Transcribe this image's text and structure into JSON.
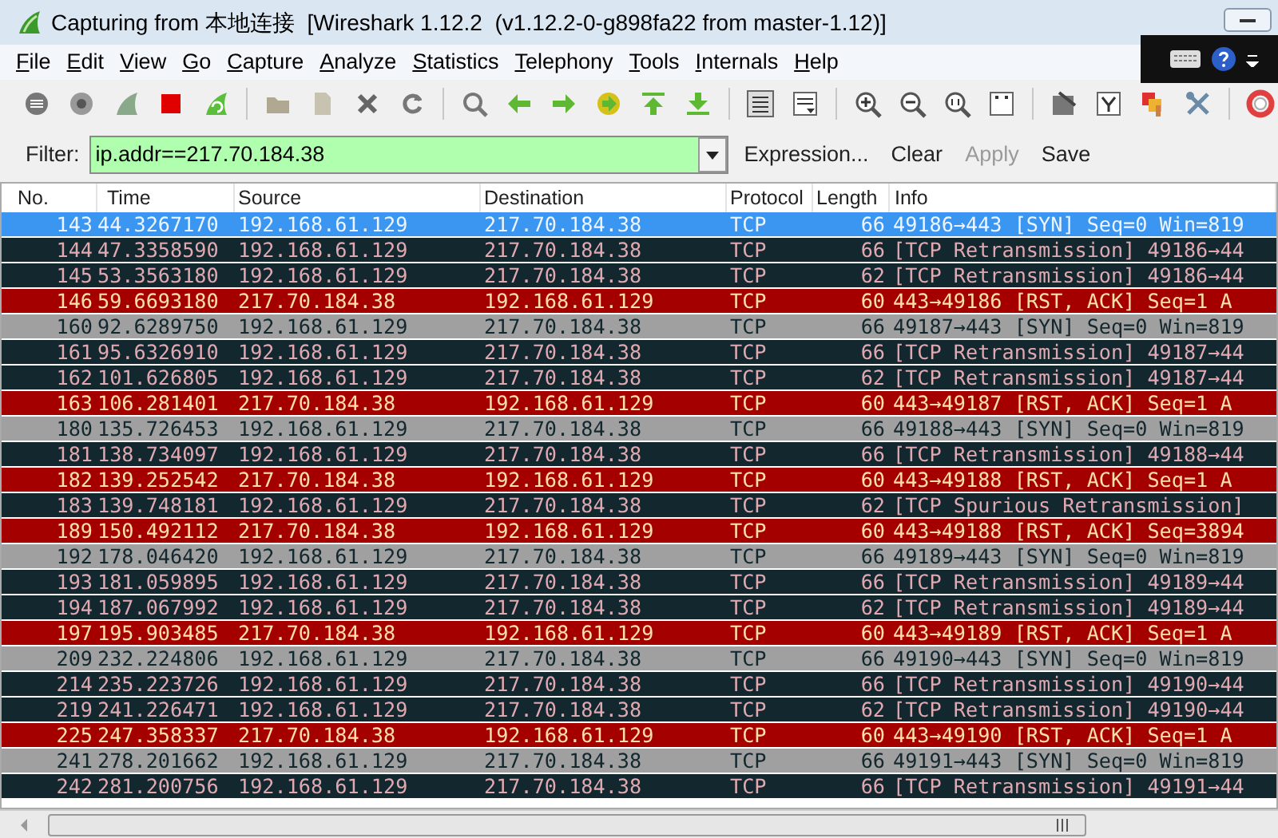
{
  "window": {
    "title": "Capturing from 本地连接  [Wireshark 1.12.2  (v1.12.2-0-g898fa22 from master-1.12)]"
  },
  "menu": [
    "File",
    "Edit",
    "View",
    "Go",
    "Capture",
    "Analyze",
    "Statistics",
    "Telephony",
    "Tools",
    "Internals",
    "Help"
  ],
  "filter": {
    "label": "Filter:",
    "value": "ip.addr==217.70.184.38"
  },
  "filter_buttons": [
    {
      "label": "Expression...",
      "disabled": false
    },
    {
      "label": "Clear",
      "disabled": false
    },
    {
      "label": "Apply",
      "disabled": true
    },
    {
      "label": "Save",
      "disabled": false
    }
  ],
  "table": {
    "columns": [
      "No.",
      "Time",
      "Source",
      "Destination",
      "Protocol",
      "Length",
      "Info"
    ],
    "rows": [
      {
        "selected": true,
        "cells": [
          "143",
          "44.3267170",
          "192.168.61.129",
          "217.70.184.38",
          "TCP",
          "66",
          "49186→443 [SYN] Seq=0 Win=819"
        ]
      },
      {
        "kind": "retransmission",
        "selected": false,
        "cells": [
          "144",
          "47.3358590",
          "192.168.61.129",
          "217.70.184.38",
          "TCP",
          "66",
          "[TCP Retransmission] 49186→44"
        ]
      },
      {
        "kind": "retransmission",
        "selected": false,
        "cells": [
          "145",
          "53.3563180",
          "192.168.61.129",
          "217.70.184.38",
          "TCP",
          "62",
          "[TCP Retransmission] 49186→44"
        ]
      },
      {
        "kind": "reset",
        "selected": false,
        "cells": [
          "146",
          "59.6693180",
          "217.70.184.38",
          "192.168.61.129",
          "TCP",
          "60",
          "443→49186 [RST, ACK] Seq=1 A"
        ]
      },
      {
        "kind": "syn",
        "selected": false,
        "cells": [
          "160",
          "92.6289750",
          "192.168.61.129",
          "217.70.184.38",
          "TCP",
          "66",
          "49187→443 [SYN] Seq=0 Win=819"
        ]
      },
      {
        "kind": "retransmission",
        "selected": false,
        "cells": [
          "161",
          "95.6326910",
          "192.168.61.129",
          "217.70.184.38",
          "TCP",
          "66",
          "[TCP Retransmission] 49187→44"
        ]
      },
      {
        "kind": "retransmission",
        "selected": false,
        "cells": [
          "162",
          "101.626805",
          "192.168.61.129",
          "217.70.184.38",
          "TCP",
          "62",
          "[TCP Retransmission] 49187→44"
        ]
      },
      {
        "kind": "reset",
        "selected": false,
        "cells": [
          "163",
          "106.281401",
          "217.70.184.38",
          "192.168.61.129",
          "TCP",
          "60",
          "443→49187 [RST, ACK] Seq=1 A"
        ]
      },
      {
        "kind": "syn",
        "selected": false,
        "cells": [
          "180",
          "135.726453",
          "192.168.61.129",
          "217.70.184.38",
          "TCP",
          "66",
          "49188→443 [SYN] Seq=0 Win=819"
        ]
      },
      {
        "kind": "retransmission",
        "selected": false,
        "cells": [
          "181",
          "138.734097",
          "192.168.61.129",
          "217.70.184.38",
          "TCP",
          "66",
          "[TCP Retransmission] 49188→44"
        ]
      },
      {
        "kind": "reset",
        "selected": false,
        "cells": [
          "182",
          "139.252542",
          "217.70.184.38",
          "192.168.61.129",
          "TCP",
          "60",
          "443→49188 [RST, ACK] Seq=1 A"
        ]
      },
      {
        "kind": "retransmission",
        "selected": false,
        "cells": [
          "183",
          "139.748181",
          "192.168.61.129",
          "217.70.184.38",
          "TCP",
          "62",
          "[TCP Spurious Retransmission]"
        ]
      },
      {
        "kind": "reset",
        "selected": false,
        "cells": [
          "189",
          "150.492112",
          "217.70.184.38",
          "192.168.61.129",
          "TCP",
          "60",
          "443→49188 [RST, ACK] Seq=3894"
        ]
      },
      {
        "kind": "syn",
        "selected": false,
        "cells": [
          "192",
          "178.046420",
          "192.168.61.129",
          "217.70.184.38",
          "TCP",
          "66",
          "49189→443 [SYN] Seq=0 Win=819"
        ]
      },
      {
        "kind": "retransmission",
        "selected": false,
        "cells": [
          "193",
          "181.059895",
          "192.168.61.129",
          "217.70.184.38",
          "TCP",
          "66",
          "[TCP Retransmission] 49189→44"
        ]
      },
      {
        "kind": "retransmission",
        "selected": false,
        "cells": [
          "194",
          "187.067992",
          "192.168.61.129",
          "217.70.184.38",
          "TCP",
          "62",
          "[TCP Retransmission] 49189→44"
        ]
      },
      {
        "kind": "reset",
        "selected": false,
        "cells": [
          "197",
          "195.903485",
          "217.70.184.38",
          "192.168.61.129",
          "TCP",
          "60",
          "443→49189 [RST, ACK] Seq=1 A"
        ]
      },
      {
        "kind": "syn",
        "selected": false,
        "cells": [
          "209",
          "232.224806",
          "192.168.61.129",
          "217.70.184.38",
          "TCP",
          "66",
          "49190→443 [SYN] Seq=0 Win=819"
        ]
      },
      {
        "kind": "retransmission",
        "selected": false,
        "cells": [
          "214",
          "235.223726",
          "192.168.61.129",
          "217.70.184.38",
          "TCP",
          "66",
          "[TCP Retransmission] 49190→44"
        ]
      },
      {
        "kind": "retransmission",
        "selected": false,
        "cells": [
          "219",
          "241.226471",
          "192.168.61.129",
          "217.70.184.38",
          "TCP",
          "62",
          "[TCP Retransmission] 49190→44"
        ]
      },
      {
        "kind": "reset",
        "selected": false,
        "cells": [
          "225",
          "247.358337",
          "217.70.184.38",
          "192.168.61.129",
          "TCP",
          "60",
          "443→49190 [RST, ACK] Seq=1 A"
        ]
      },
      {
        "kind": "syn",
        "selected": false,
        "cells": [
          "241",
          "278.201662",
          "192.168.61.129",
          "217.70.184.38",
          "TCP",
          "66",
          "49191→443 [SYN] Seq=0 Win=819"
        ]
      },
      {
        "kind": "retransmission",
        "selected": false,
        "cells": [
          "242",
          "281.200756",
          "192.168.61.129",
          "217.70.184.38",
          "TCP",
          "66",
          "[TCP Retransmission] 49191→44"
        ]
      }
    ]
  }
}
